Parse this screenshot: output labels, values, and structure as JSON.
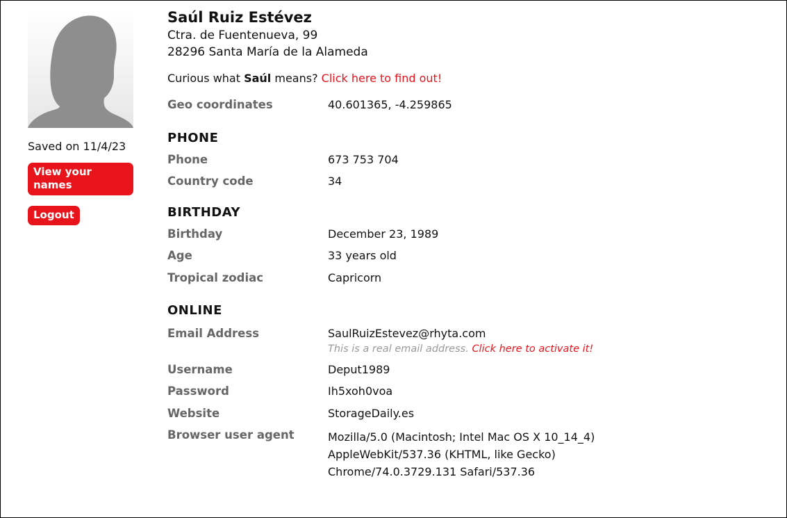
{
  "profile": {
    "name": "Saúl Ruiz Estévez",
    "address_line1": "Ctra. de Fuentenueva, 99",
    "address_line2": "28296 Santa María de la Alameda",
    "curious_prefix": "Curious what ",
    "curious_name": "Saúl",
    "curious_suffix": " means? ",
    "curious_link": "Click here to find out!"
  },
  "sidebar": {
    "saved_text": "Saved on 11/4/23",
    "view_button": "View your names",
    "logout_button": "Logout"
  },
  "geo": {
    "label": "Geo coordinates",
    "value": "40.601365, -4.259865"
  },
  "phone_section": {
    "title": "PHONE",
    "phone_label": "Phone",
    "phone_value": "673 753 704",
    "country_label": "Country code",
    "country_value": "34"
  },
  "birthday_section": {
    "title": "BIRTHDAY",
    "birthday_label": "Birthday",
    "birthday_value": "December 23, 1989",
    "age_label": "Age",
    "age_value": "33 years old",
    "zodiac_label": "Tropical zodiac",
    "zodiac_value": "Capricorn"
  },
  "online_section": {
    "title": "ONLINE",
    "email_label": "Email Address",
    "email_value": "SaulRuizEstevez@rhyta.com",
    "email_note": "This is a real email address. ",
    "email_link": "Click here to activate it!",
    "username_label": "Username",
    "username_value": "Deput1989",
    "password_label": "Password",
    "password_value": "Ih5xoh0voa",
    "website_label": "Website",
    "website_value": "StorageDaily.es",
    "ua_label": "Browser user agent",
    "ua_line1": "Mozilla/5.0 (Macintosh; Intel Mac OS X 10_14_4)",
    "ua_line2": "AppleWebKit/537.36 (KHTML, like Gecko)",
    "ua_line3": "Chrome/74.0.3729.131 Safari/537.36"
  }
}
